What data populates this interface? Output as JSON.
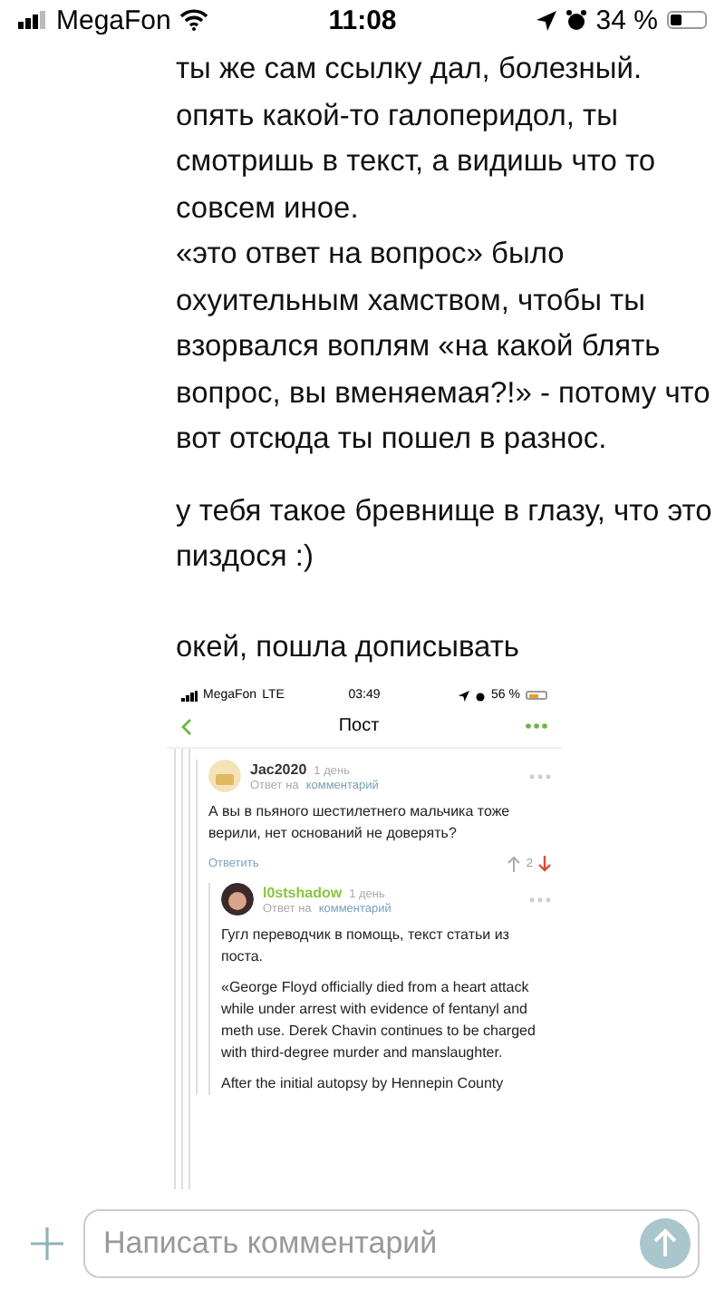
{
  "status_bar": {
    "carrier": "MegaFon",
    "time": "11:08",
    "battery": "34 %"
  },
  "message": {
    "paragraphs": [
      [
        "ты же сам ссылку дал, болезный.",
        "опять какой-то галоперидол, ты смотришь в текст, а видишь что то совсем иное.",
        "«это ответ на вопрос» было охуительным хамством, чтобы ты взорвался воплям «на какой блять вопрос, вы вменяемая?!» - потому что вот отсюда ты пошел в разнос."
      ],
      [
        "у тебя такое бревнище в глазу, что это пиздося :)"
      ],
      [
        "окей, пошла дописывать"
      ]
    ]
  },
  "screenshot": {
    "status_bar": {
      "carrier": "MegaFon",
      "network": "LTE",
      "time": "03:49",
      "battery": "56 %"
    },
    "nav": {
      "title": "Пост"
    },
    "comments": [
      {
        "author": "Jac2020",
        "color": "#333333",
        "time": "1 день",
        "reply_prefix": "Ответ на",
        "reply_link": "комментарий",
        "paragraphs": [
          "А вы в пьяного шестилетнего мальчика тоже верили, нет оснований не доверять?"
        ],
        "reply_button": "Ответить",
        "score": "2",
        "children": [
          {
            "author": "l0stshadow",
            "color": "#8ac43f",
            "time": "1 день",
            "reply_prefix": "Ответ на",
            "reply_link": "комментарий",
            "paragraphs": [
              "Гугл переводчик в помощь, текст статьи из поста.",
              "«George Floyd officially died from a heart attack while under arrest with evidence of fentanyl and meth use. Derek Chavin continues to be charged with third-degree murder and manslaughter.",
              "After the initial autopsy by Hennepin County"
            ]
          }
        ]
      }
    ]
  },
  "composer": {
    "placeholder": "Написать комментарий"
  }
}
